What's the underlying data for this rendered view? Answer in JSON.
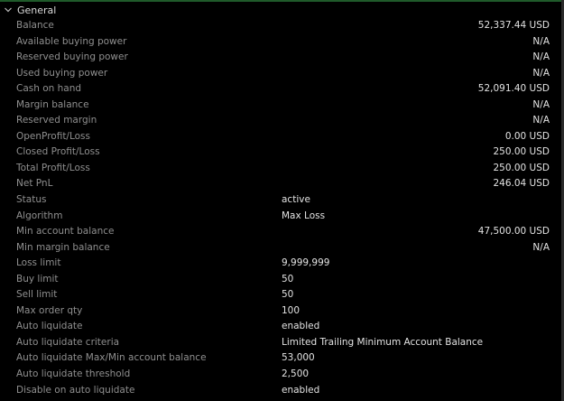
{
  "section": {
    "title": "General",
    "chevron_icon": "chevron-down-icon"
  },
  "colors": {
    "background": "#000000",
    "label": "#8f8f8f",
    "value": "#e2e2e2",
    "accent_line": "#1f5a2a"
  },
  "rows": [
    {
      "label": "Balance",
      "value": "52,337.44 USD",
      "align": "right"
    },
    {
      "label": "Available buying power",
      "value": "N/A",
      "align": "right"
    },
    {
      "label": "Reserved buying power",
      "value": "N/A",
      "align": "right"
    },
    {
      "label": "Used buying power",
      "value": "N/A",
      "align": "right"
    },
    {
      "label": "Cash on hand",
      "value": "52,091.40 USD",
      "align": "right"
    },
    {
      "label": "Margin balance",
      "value": "N/A",
      "align": "right"
    },
    {
      "label": "Reserved margin",
      "value": "N/A",
      "align": "right"
    },
    {
      "label": "OpenProfit/Loss",
      "value": "0.00 USD",
      "align": "right"
    },
    {
      "label": "Closed Profit/Loss",
      "value": "250.00 USD",
      "align": "right"
    },
    {
      "label": "Total Profit/Loss",
      "value": "250.00 USD",
      "align": "right"
    },
    {
      "label": "Net PnL",
      "value": "246.04 USD",
      "align": "right"
    },
    {
      "label": "Status",
      "value": "active",
      "align": "mid"
    },
    {
      "label": "Algorithm",
      "value": "Max Loss",
      "align": "mid"
    },
    {
      "label": "Min account balance",
      "value": "47,500.00 USD",
      "align": "right"
    },
    {
      "label": "Min margin balance",
      "value": "N/A",
      "align": "right"
    },
    {
      "label": "Loss limit",
      "value": "9,999,999",
      "align": "mid"
    },
    {
      "label": "Buy limit",
      "value": "50",
      "align": "mid"
    },
    {
      "label": "Sell limit",
      "value": "50",
      "align": "mid"
    },
    {
      "label": "Max order qty",
      "value": "100",
      "align": "mid"
    },
    {
      "label": "Auto liquidate",
      "value": "enabled",
      "align": "mid"
    },
    {
      "label": "Auto liquidate criteria",
      "value": "Limited Trailing Minimum Account Balance",
      "align": "mid"
    },
    {
      "label": "Auto liquidate Max/Min account balance",
      "value": "53,000",
      "align": "mid"
    },
    {
      "label": "Auto liquidate threshold",
      "value": "2,500",
      "align": "mid"
    },
    {
      "label": "Disable on auto liquidate",
      "value": "enabled",
      "align": "mid"
    }
  ]
}
